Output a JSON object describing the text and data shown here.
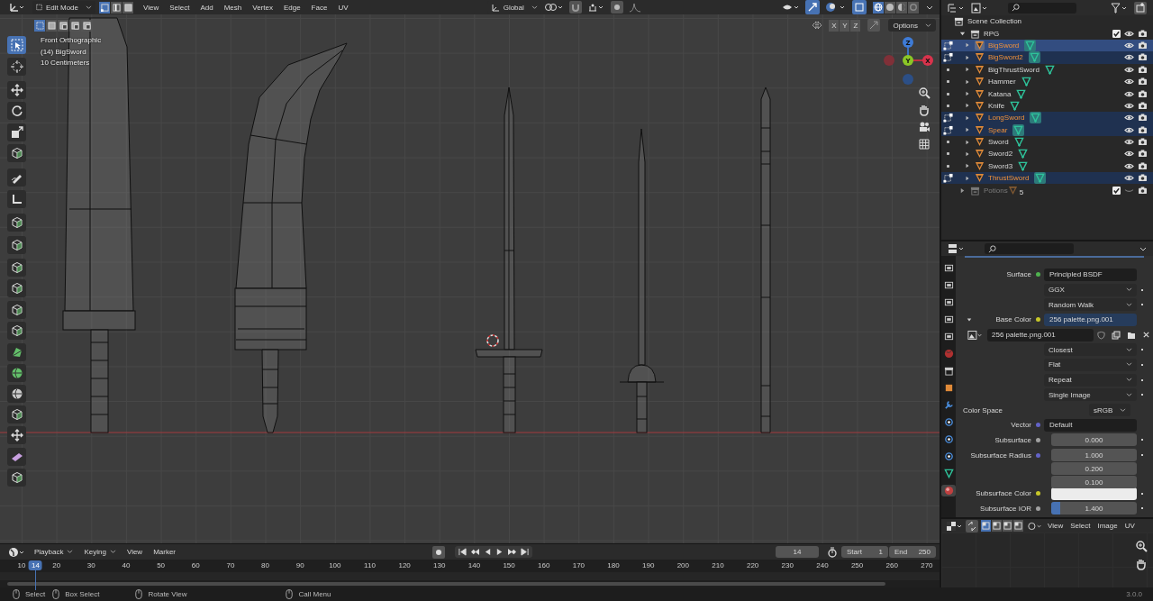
{
  "viewport_header": {
    "mode": "Edit Mode",
    "select_modes": [
      {
        "selected": true
      },
      {
        "selected": false
      },
      {
        "selected": false
      }
    ],
    "menus": [
      "View",
      "Select",
      "Add",
      "Mesh",
      "Vertex",
      "Edge",
      "Face",
      "UV"
    ],
    "orientation": "Global",
    "box_modes": [
      {
        "selected": true
      },
      {
        "selected": false
      },
      {
        "selected": false
      },
      {
        "selected": false
      },
      {
        "selected": false
      }
    ],
    "shading_modes": [
      {
        "selected": true
      },
      {
        "selected": false
      },
      {
        "selected": false
      },
      {
        "selected": false
      }
    ],
    "axes": [
      {
        "label": "X",
        "selected": false
      },
      {
        "label": "Y",
        "selected": false
      },
      {
        "label": "Z",
        "selected": false
      }
    ],
    "options": "Options"
  },
  "viewport": {
    "info": [
      "Front Orthographic",
      "(14) BigSword",
      "10 Centimeters"
    ],
    "gizmo": [
      "Z",
      "Y",
      "X"
    ]
  },
  "toolbar": [
    {
      "kind": "select",
      "selected": true
    },
    {
      "kind": "cursor",
      "selected": false
    },
    {
      "kind": "move",
      "selected": false
    },
    {
      "kind": "rotate",
      "selected": false
    },
    {
      "kind": "scale",
      "selected": false
    },
    {
      "kind": "cube",
      "selected": false
    },
    {
      "kind": "pen",
      "selected": false
    },
    {
      "kind": "ruler",
      "selected": false
    },
    {
      "kind": "cube",
      "selected": false
    },
    {
      "kind": "cube",
      "selected": false
    },
    {
      "kind": "cube",
      "selected": false
    },
    {
      "kind": "cube",
      "selected": false
    },
    {
      "kind": "cube",
      "selected": false
    },
    {
      "kind": "cube",
      "selected": false
    },
    {
      "kind": "poly",
      "selected": false
    },
    {
      "kind": "sphere",
      "selected": false
    },
    {
      "kind": "sphere",
      "selected": false
    },
    {
      "kind": "cube",
      "selected": false
    },
    {
      "kind": "move",
      "selected": false
    },
    {
      "kind": "wedge",
      "selected": false
    },
    {
      "kind": "cube",
      "selected": false
    }
  ],
  "outliner": {
    "root": "Scene Collection",
    "collections": [
      {
        "name": "RPG",
        "expanded": true,
        "enabled": true,
        "checked": true,
        "children": [
          {
            "name": "BigSword",
            "selected": true,
            "active": true
          },
          {
            "name": "BigSword2",
            "selected": true,
            "active": false
          },
          {
            "name": "BigThrustSword",
            "selected": false,
            "active": false
          },
          {
            "name": "Hammer",
            "selected": false,
            "active": false
          },
          {
            "name": "Katana",
            "selected": false,
            "active": false
          },
          {
            "name": "Knife",
            "selected": false,
            "active": false
          },
          {
            "name": "LongSword",
            "selected": true,
            "active": false
          },
          {
            "name": "Spear",
            "selected": true,
            "active": false
          },
          {
            "name": "Sword",
            "selected": false,
            "active": false
          },
          {
            "name": "Sword2",
            "selected": false,
            "active": false
          },
          {
            "name": "Sword3",
            "selected": false,
            "active": false
          },
          {
            "name": "ThrustSword",
            "selected": true,
            "active": false
          }
        ]
      },
      {
        "name": "Potions",
        "expanded": false,
        "enabled": false,
        "checked": true,
        "count": "5"
      }
    ]
  },
  "properties": {
    "tabs": [
      {
        "kind": "tool",
        "selected": false
      },
      {
        "kind": "render",
        "selected": false
      },
      {
        "kind": "output",
        "selected": false
      },
      {
        "kind": "view",
        "selected": false
      },
      {
        "kind": "scene",
        "selected": false
      },
      {
        "kind": "world",
        "selected": false
      },
      {
        "kind": "collection",
        "selected": false
      },
      {
        "kind": "object",
        "selected": false
      },
      {
        "kind": "modifier",
        "selected": false
      },
      {
        "kind": "particles",
        "selected": false
      },
      {
        "kind": "physics",
        "selected": false
      },
      {
        "kind": "constraint",
        "selected": false
      },
      {
        "kind": "data",
        "selected": false
      },
      {
        "kind": "material",
        "selected": true
      }
    ],
    "rows": [
      {
        "kind": "socket",
        "label": "Surface",
        "value": "Principled BSDF",
        "socket": {
          "color": "#4fb24f"
        }
      },
      {
        "kind": "dropdown",
        "value": "GGX"
      },
      {
        "kind": "dropdown",
        "value": "Random Walk"
      },
      {
        "kind": "socket",
        "label": "Base Color",
        "value": "256 palette.png.001",
        "socket": {
          "color": "#c7c729"
        },
        "expanded": true
      },
      {
        "kind": "image",
        "value": "256 palette.png.001"
      },
      {
        "kind": "dropdown",
        "value": "Closest"
      },
      {
        "kind": "dropdown",
        "value": "Flat"
      },
      {
        "kind": "dropdown",
        "value": "Repeat"
      },
      {
        "kind": "dropdown",
        "value": "Single Image"
      },
      {
        "kind": "select",
        "label": "Color Space",
        "value": "sRGB"
      },
      {
        "kind": "socket",
        "label": "Vector",
        "value": "Default",
        "socket": {
          "color": "#6363c7"
        }
      },
      {
        "kind": "number",
        "label": "Subsurface",
        "values": [
          "0.000"
        ],
        "socket": {
          "color": "#a1a1a1"
        }
      },
      {
        "kind": "number",
        "label": "Subsurface Radius",
        "values": [
          "1.000",
          "0.200",
          "0.100"
        ],
        "socket": {
          "color": "#6363c7"
        }
      },
      {
        "kind": "color",
        "label": "Subsurface Color",
        "socket": {
          "color": "#c7c729"
        },
        "color": "#ececec"
      },
      {
        "kind": "number",
        "label": "Subsurface IOR",
        "values": [
          "1.400"
        ],
        "socket": {
          "color": "#a1a1a1"
        },
        "level": 0.1
      }
    ]
  },
  "image_editor": {
    "menus": [
      "View",
      "Select",
      "Image",
      "UV"
    ]
  },
  "timeline": {
    "menus": [
      {
        "label": "Playback",
        "kind": "dropdown"
      },
      {
        "label": "Keying",
        "kind": "dropdown"
      },
      {
        "label": "View",
        "kind": "menu"
      },
      {
        "label": "Marker",
        "kind": "menu"
      }
    ],
    "current_frame": "14",
    "start_label": "Start",
    "start": "1",
    "end_label": "End",
    "end": "250",
    "ruler": [
      "10",
      "20",
      "30",
      "40",
      "50",
      "60",
      "70",
      "80",
      "90",
      "100",
      "110",
      "120",
      "130",
      "140",
      "150",
      "160",
      "170",
      "180",
      "190",
      "200",
      "210",
      "220",
      "230",
      "240",
      "250",
      "260",
      "270"
    ],
    "cursor_frame": "14"
  },
  "status_bar": {
    "actions": [
      "Select",
      "Box Select",
      "Rotate View",
      "Call Menu"
    ],
    "version": "3.0.0"
  }
}
